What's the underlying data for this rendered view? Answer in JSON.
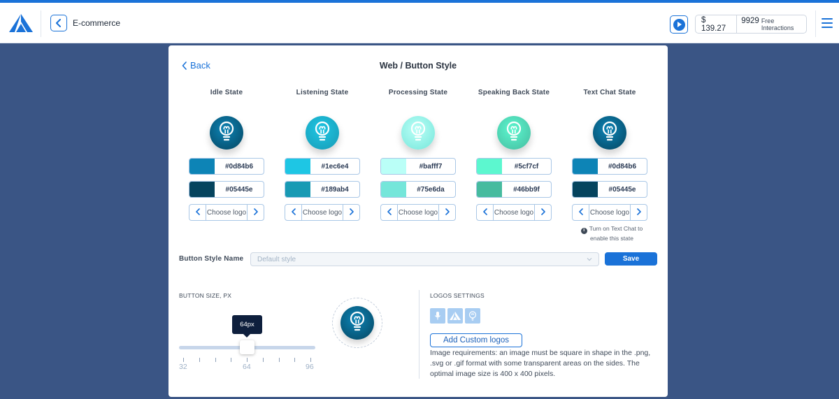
{
  "header": {
    "project_title": "E-commerce",
    "balance": "$ 139.27",
    "interactions_count": "9929",
    "interactions_label": "Free Interactions"
  },
  "panel": {
    "back_label": "Back",
    "title": "Web / Button Style"
  },
  "states": [
    {
      "title": "Idle State",
      "circle_color": "#0d84b6",
      "circle_color2": "#05445e",
      "colors": [
        {
          "hex": "#0d84b6"
        },
        {
          "hex": "#05445e"
        }
      ],
      "chooser_label": "Choose logo"
    },
    {
      "title": "Listening State",
      "circle_color": "#1ec6e4",
      "circle_color2": "#189ab4",
      "colors": [
        {
          "hex": "#1ec6e4"
        },
        {
          "hex": "#189ab4"
        }
      ],
      "chooser_label": "Choose logo"
    },
    {
      "title": "Processing State",
      "circle_color": "#bafff7",
      "circle_color2": "#75e6da",
      "colors": [
        {
          "hex": "#bafff7"
        },
        {
          "hex": "#75e6da"
        }
      ],
      "chooser_label": "Choose logo"
    },
    {
      "title": "Speaking Back State",
      "circle_color": "#5cf7cf",
      "circle_color2": "#46bb9f",
      "colors": [
        {
          "hex": "#5cf7cf"
        },
        {
          "hex": "#46bb9f"
        }
      ],
      "chooser_label": "Choose logo"
    },
    {
      "title": "Text Chat State",
      "circle_color": "#0d84b6",
      "circle_color2": "#05445e",
      "colors": [
        {
          "hex": "#0d84b6"
        },
        {
          "hex": "#05445e"
        }
      ],
      "chooser_label": "Choose logo"
    }
  ],
  "text_chat_note": "Turn on Text Chat to enable this state",
  "button_style": {
    "label": "Button Style Name",
    "placeholder": "Default style",
    "save_label": "Save"
  },
  "button_size": {
    "label": "BUTTON SIZE, PX",
    "value_label": "64px",
    "value": 64,
    "min": 32,
    "max": 96,
    "tick_labels": [
      "32",
      "64",
      "96"
    ]
  },
  "logos_settings": {
    "label": "LOGOS SETTINGS",
    "options": [
      "microphone-icon",
      "brand-logo-icon",
      "lightbulb-icon"
    ],
    "add_label": "Add Custom logos",
    "requirements": "Image requirements: an image must be square in shape in the .png, .svg or .gif format with some transparent areas on the sides. The optimal image size is 400 x 400 pixels."
  },
  "colors": {
    "accent": "#1a72d8",
    "background": "#3a5585",
    "tooltip": "#0e1f3d"
  }
}
